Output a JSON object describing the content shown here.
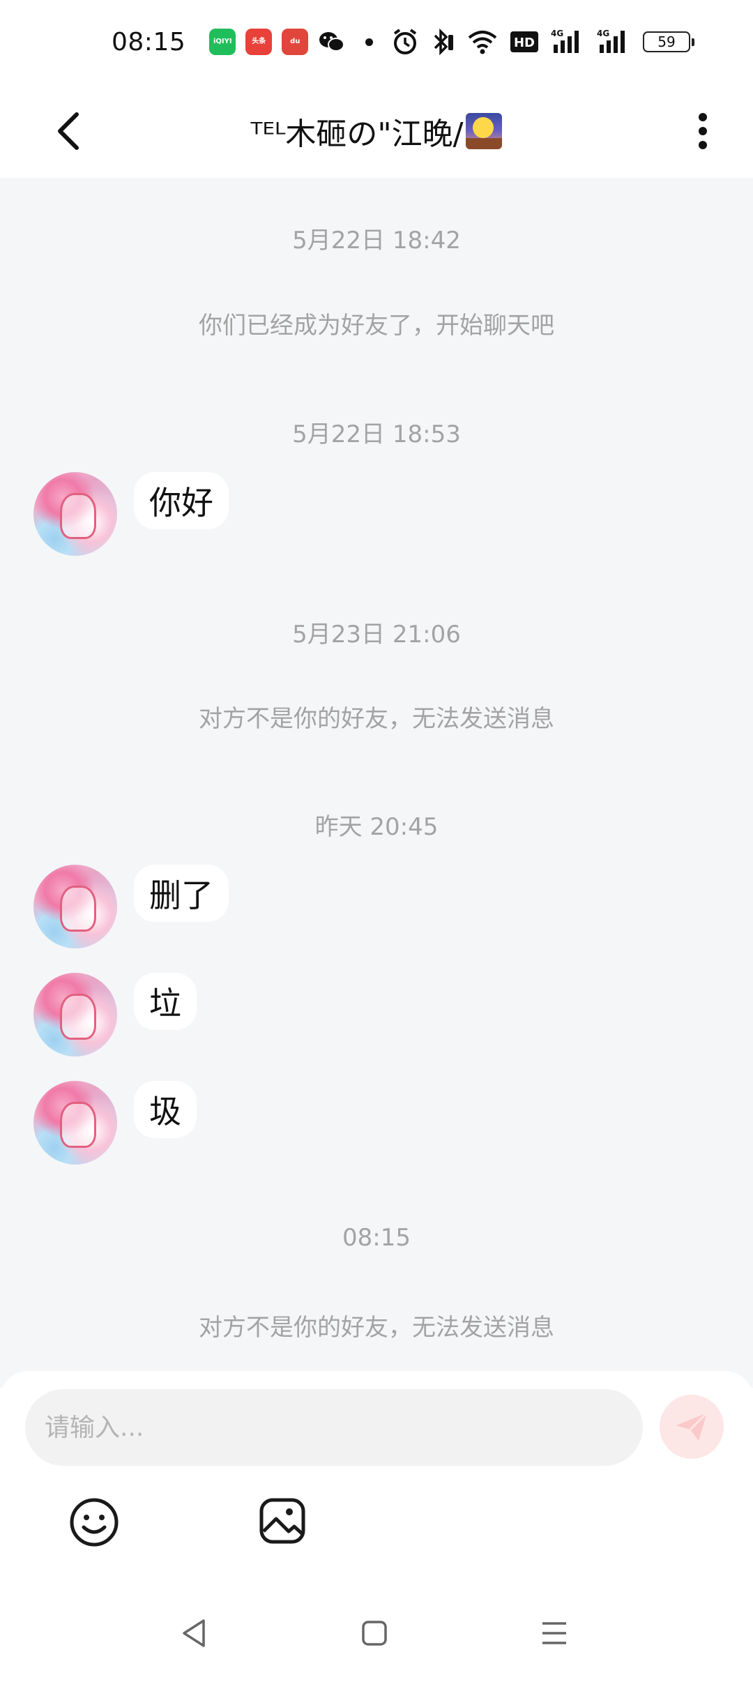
{
  "status_bar": {
    "time": "08:15",
    "app_icons": [
      {
        "name": "iqiyi-icon",
        "text": "iQIYI",
        "color": "#1fbe5a"
      },
      {
        "name": "toutiao-icon",
        "text": "头条",
        "color": "#e8413a"
      },
      {
        "name": "baidu-icon",
        "text": "du",
        "color": "#e0463b"
      },
      {
        "name": "wechat-icon",
        "text": "",
        "color": "#111111"
      }
    ],
    "network_badge": "HD",
    "signal_label_1": "4G",
    "signal_label_2": "4G",
    "battery": "59"
  },
  "header": {
    "title": "ᵀᴱᴸ木砸の\"江晚/",
    "title_emoji": "moon-night-icon"
  },
  "chat": {
    "messages": [
      {
        "type": "timestamp",
        "text": "5月22日 18:42"
      },
      {
        "type": "system",
        "text": "你们已经成为好友了，开始聊天吧"
      },
      {
        "type": "timestamp",
        "text": "5月22日 18:53"
      },
      {
        "type": "incoming",
        "text": "你好"
      },
      {
        "type": "timestamp",
        "text": "5月23日 21:06"
      },
      {
        "type": "system",
        "text": "对方不是你的好友，无法发送消息"
      },
      {
        "type": "timestamp",
        "text": "昨天 20:45"
      },
      {
        "type": "incoming",
        "text": "删了"
      },
      {
        "type": "incoming",
        "text": "垃"
      },
      {
        "type": "incoming",
        "text": "圾"
      },
      {
        "type": "timestamp",
        "text": "08:15"
      },
      {
        "type": "system",
        "text": "对方不是你的好友，无法发送消息"
      }
    ]
  },
  "composer": {
    "placeholder": "请输入...",
    "value": "",
    "send_color": "#fde6e6",
    "icons": [
      "emoji-icon",
      "image-icon"
    ]
  },
  "nav_bar": {
    "icons": [
      "nav-back-icon",
      "nav-home-icon",
      "nav-menu-icon"
    ]
  }
}
